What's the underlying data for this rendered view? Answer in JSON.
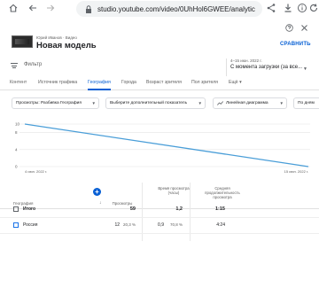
{
  "browser": {
    "url": "studio.youtube.com/video/0UhHol6GWEE/analytic",
    "icons": [
      "home-icon",
      "back-icon",
      "forward-icon",
      "lock-icon",
      "share-icon",
      "download-icon",
      "info-icon",
      "refresh-icon"
    ]
  },
  "video": {
    "channel": "Юрий Иванов · Видео",
    "title": "Новая модель",
    "subscribe_label": "СРАВНИТЬ"
  },
  "filter": {
    "label": "Фильтр",
    "range_small": "4–15 июн. 2022 г.",
    "range_main": "С момента загрузки (за все..."
  },
  "tabs": [
    {
      "label": "Контент"
    },
    {
      "label": "Источник трафика"
    },
    {
      "label": "География"
    },
    {
      "label": "Города"
    },
    {
      "label": "Возраст зрителя"
    },
    {
      "label": "Пол зрителя"
    },
    {
      "label": "Ещё"
    }
  ],
  "chips": {
    "metric": "Просмотры: Разбивка География",
    "secondary": "Выберите дополнительный показатель",
    "chart_type": "Линейная диаграмма",
    "period": "По дням"
  },
  "chart_data": {
    "type": "line",
    "x": [
      "4 июн. 2022 г.",
      "15 июн. 2022 г."
    ],
    "series": [
      {
        "values": [
          10,
          0
        ]
      }
    ],
    "yticks": [
      "10",
      "8",
      "4",
      "0"
    ],
    "ylim": [
      0,
      10
    ],
    "grid": true,
    "colors": {
      "line": "#4a9ed8",
      "grid": "#e5e5e5"
    }
  },
  "table": {
    "geo_header": "География",
    "columns": [
      {
        "label": "Просмотры"
      },
      {
        "label": "Время просмотра (часы)"
      },
      {
        "label": "Средняя продолжительность просмотра"
      }
    ],
    "total": {
      "label": "Итого",
      "views": "59",
      "watch_time": "1,2",
      "avg_duration": "1:15"
    },
    "rows": [
      {
        "label": "Россия",
        "views": "12",
        "views_pct": "20,3 %",
        "watch_time": "0,9",
        "watch_pct": "70,8 %",
        "avg_duration": "4:24"
      }
    ]
  }
}
